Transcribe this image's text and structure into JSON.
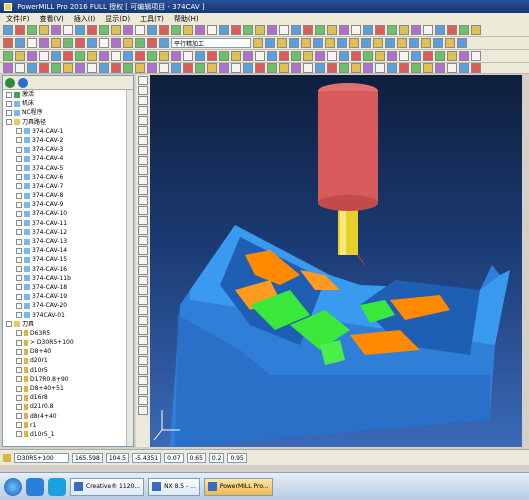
{
  "window": {
    "title": "PowerMILL Pro 2016 FULL 授权 [ 可编辑项目 - 374CAV ]"
  },
  "menu": {
    "items": [
      "文件(F)",
      "查看(V)",
      "插入(I)",
      "显示(D)",
      "工具(T)",
      "帮助(H)"
    ]
  },
  "toolbar": {
    "strategy_combo": "平行精加工"
  },
  "explorer": {
    "items": [
      {
        "label": "激活",
        "level": 0,
        "type": "green"
      },
      {
        "label": "机床",
        "level": 0,
        "type": "node"
      },
      {
        "label": "NC程序",
        "level": 0,
        "type": "node"
      },
      {
        "label": "刀具路径",
        "level": 0,
        "type": "folder"
      },
      {
        "label": "374-CAV-1",
        "level": 1,
        "type": "path"
      },
      {
        "label": "374-CAV-2",
        "level": 1,
        "type": "path"
      },
      {
        "label": "374-CAV-3",
        "level": 1,
        "type": "path"
      },
      {
        "label": "374-CAV-4",
        "level": 1,
        "type": "path"
      },
      {
        "label": "374-CAV-5",
        "level": 1,
        "type": "path"
      },
      {
        "label": "374-CAV-6",
        "level": 1,
        "type": "path"
      },
      {
        "label": "374-CAV-7",
        "level": 1,
        "type": "path"
      },
      {
        "label": "374-CAV-8",
        "level": 1,
        "type": "path"
      },
      {
        "label": "374-CAV-9",
        "level": 1,
        "type": "path"
      },
      {
        "label": "374-CAV-10",
        "level": 1,
        "type": "path"
      },
      {
        "label": "374-CAV-11",
        "level": 1,
        "type": "path"
      },
      {
        "label": "374-CAV-12",
        "level": 1,
        "type": "path"
      },
      {
        "label": "374-CAV-13",
        "level": 1,
        "type": "path"
      },
      {
        "label": "374-CAV-14",
        "level": 1,
        "type": "path"
      },
      {
        "label": "374-CAV-15",
        "level": 1,
        "type": "path"
      },
      {
        "label": "374-CAV-16",
        "level": 1,
        "type": "path"
      },
      {
        "label": "374-CAV-11b",
        "level": 1,
        "type": "path"
      },
      {
        "label": "374-CAV-18",
        "level": 1,
        "type": "path"
      },
      {
        "label": "374-CAV-19",
        "level": 1,
        "type": "path"
      },
      {
        "label": "374-CAV-20",
        "level": 1,
        "type": "path"
      },
      {
        "label": "374CAV-01",
        "level": 1,
        "type": "path"
      },
      {
        "label": "刀具",
        "level": 0,
        "type": "folder"
      },
      {
        "label": "D63R5",
        "level": 1,
        "type": "tool"
      },
      {
        "label": "> D30R5+100",
        "level": 1,
        "type": "tool"
      },
      {
        "label": "D8+40",
        "level": 1,
        "type": "tool"
      },
      {
        "label": "d20r1",
        "level": 1,
        "type": "tool"
      },
      {
        "label": "d10r5",
        "level": 1,
        "type": "tool"
      },
      {
        "label": "D17R0.8+90",
        "level": 1,
        "type": "tool"
      },
      {
        "label": "D8+40+51",
        "level": 1,
        "type": "tool"
      },
      {
        "label": "d16r8",
        "level": 1,
        "type": "tool"
      },
      {
        "label": "d21r0.8",
        "level": 1,
        "type": "tool"
      },
      {
        "label": "d8r4+40",
        "level": 1,
        "type": "tool"
      },
      {
        "label": "r1",
        "level": 1,
        "type": "tool"
      },
      {
        "label": "d10r5_1",
        "level": 1,
        "type": "tool"
      }
    ]
  },
  "status": {
    "tool_combo": "D30R5+100",
    "x": "165.598",
    "y": "104.5",
    "z": "-5.4351",
    "tol": "0.07",
    "thickness": "0.65",
    "stepover": "0.2",
    "extra": "0.95"
  },
  "taskbar": {
    "buttons": [
      {
        "label": "Creative® 1120...",
        "active": false
      },
      {
        "label": "NX 8.5 - ...",
        "active": false
      },
      {
        "label": "PowerMILL Pro...",
        "active": true
      }
    ]
  },
  "colors": {
    "part": "#3a8ee8",
    "holder": "#d85a5a",
    "cutter": "#e8d02a",
    "toolpath_green": "#3ae83a",
    "toolpath_orange": "#ff8a00"
  }
}
